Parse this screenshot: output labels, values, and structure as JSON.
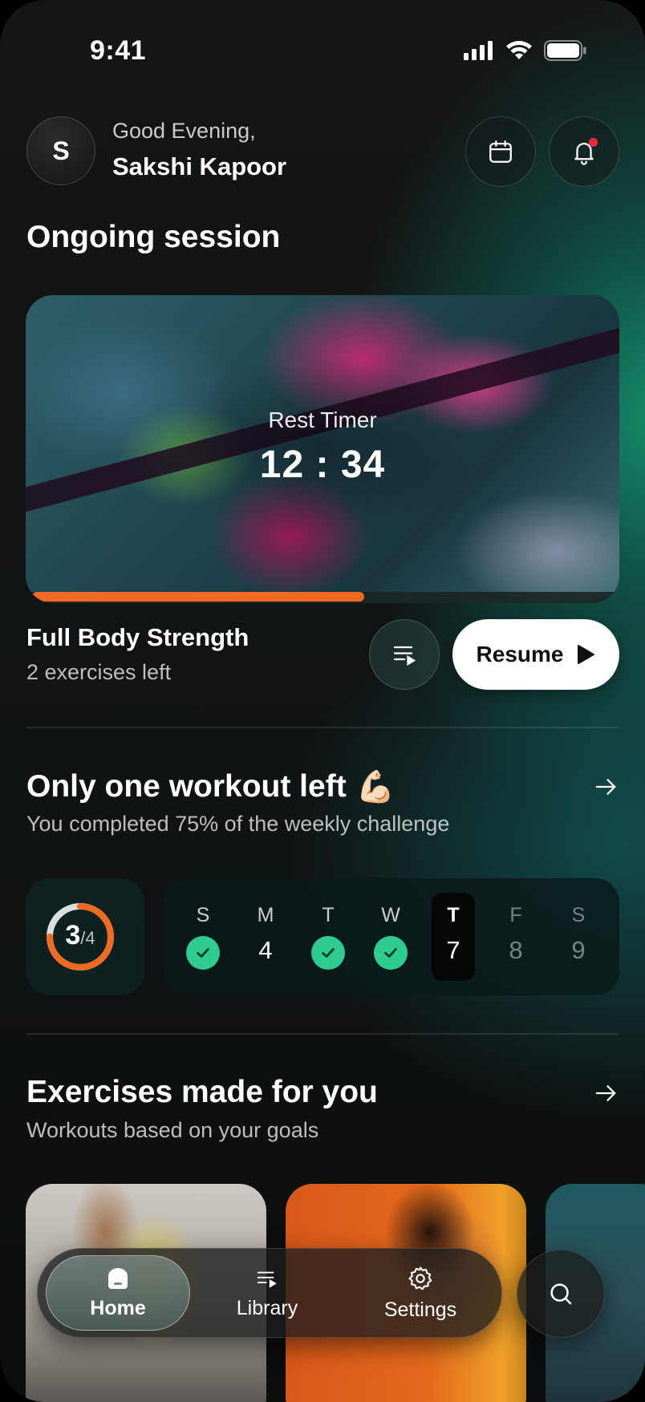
{
  "status_bar": {
    "time": "9:41"
  },
  "header": {
    "avatar_initial": "S",
    "greeting": "Good Evening,",
    "user_name": "Sakshi Kapoor",
    "calendar_icon": "calendar-icon",
    "bell_icon": "bell-icon"
  },
  "ongoing": {
    "section_title": "Ongoing session",
    "timer_label": "Rest Timer",
    "timer_value": "12 : 34",
    "progress": 0.56,
    "workout_name": "Full Body Strength",
    "workout_sub": "2 exercises left",
    "resume_label": "Resume"
  },
  "challenge": {
    "title": "Only one workout left",
    "emoji": "💪🏻",
    "subtitle": "You completed 75% of the weekly challenge",
    "done": "3",
    "total": "/4",
    "ratio": 0.75,
    "days": [
      {
        "label": "S",
        "value": "",
        "state": "done"
      },
      {
        "label": "M",
        "value": "4",
        "state": "missed"
      },
      {
        "label": "T",
        "value": "",
        "state": "done"
      },
      {
        "label": "W",
        "value": "",
        "state": "done"
      },
      {
        "label": "T",
        "value": "7",
        "state": "today"
      },
      {
        "label": "F",
        "value": "8",
        "state": "future"
      },
      {
        "label": "S",
        "value": "9",
        "state": "future"
      }
    ]
  },
  "exercises": {
    "title": "Exercises made for you",
    "subtitle": "Workouts based on your goals"
  },
  "nav": {
    "home": "Home",
    "library": "Library",
    "settings": "Settings"
  },
  "colors": {
    "accent": "#F06A22",
    "check": "#2ECC8E"
  }
}
